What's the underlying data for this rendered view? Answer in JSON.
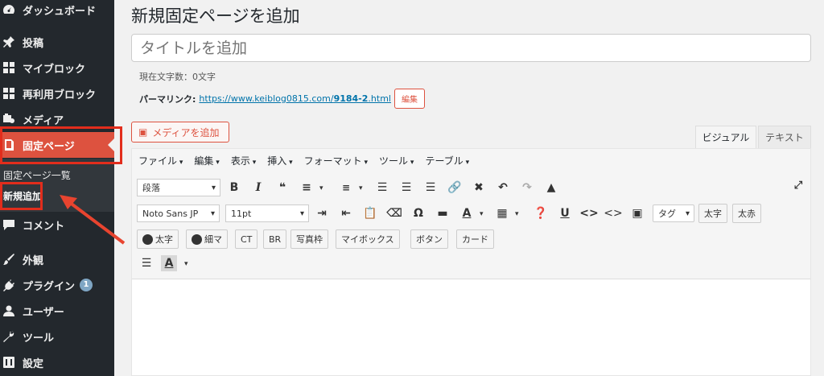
{
  "sidebar": {
    "items": [
      {
        "label": "ダッシュボード",
        "icon": "dashboard-icon"
      },
      {
        "label": "投稿",
        "icon": "pin-icon"
      },
      {
        "label": "マイブロック",
        "icon": "blocks-icon"
      },
      {
        "label": "再利用ブロック",
        "icon": "blocks-icon"
      },
      {
        "label": "メディア",
        "icon": "media-icon"
      },
      {
        "label": "固定ページ",
        "icon": "page-icon"
      },
      {
        "label": "コメント",
        "icon": "comment-icon"
      },
      {
        "label": "外観",
        "icon": "brush-icon"
      },
      {
        "label": "プラグイン",
        "icon": "plugin-icon",
        "badge": "1"
      },
      {
        "label": "ユーザー",
        "icon": "user-icon"
      },
      {
        "label": "ツール",
        "icon": "wrench-icon"
      },
      {
        "label": "設定",
        "icon": "settings-icon"
      }
    ],
    "submenu": [
      "固定ページ一覧",
      "新規追加"
    ]
  },
  "main": {
    "page_title": "新規固定ページを追加",
    "title_placeholder": "タイトルを追加",
    "char_count": "現在文字数：0文字",
    "permalink_label": "パーマリンク:",
    "permalink_prefix": "https://www.keiblog0815.com/",
    "permalink_slug": "9184-2",
    "permalink_suffix": ".html",
    "edit_label": "編集",
    "media_button": "メディアを追加",
    "tabs": [
      "ビジュアル",
      "テキスト"
    ]
  },
  "editor": {
    "menus": [
      "ファイル",
      "編集",
      "表示",
      "挿入",
      "フォーマット",
      "ツール",
      "テーブル"
    ],
    "format_select": "段落",
    "font_select": "Noto Sans JP",
    "size_select": "11pt",
    "tag_select": "タグ",
    "row2_buttons": [
      "太字",
      "太赤"
    ],
    "row3_buttons": [
      "太字",
      "細マ",
      "CT",
      "BR",
      "写真枠",
      "マイボックス",
      "ボタン",
      "カード"
    ],
    "text_color_letter": "A"
  },
  "colors": {
    "accent": "#dd523f",
    "sidebar_bg": "#23282d",
    "link": "#0073aa",
    "annotation_red": "#e22d1c"
  }
}
